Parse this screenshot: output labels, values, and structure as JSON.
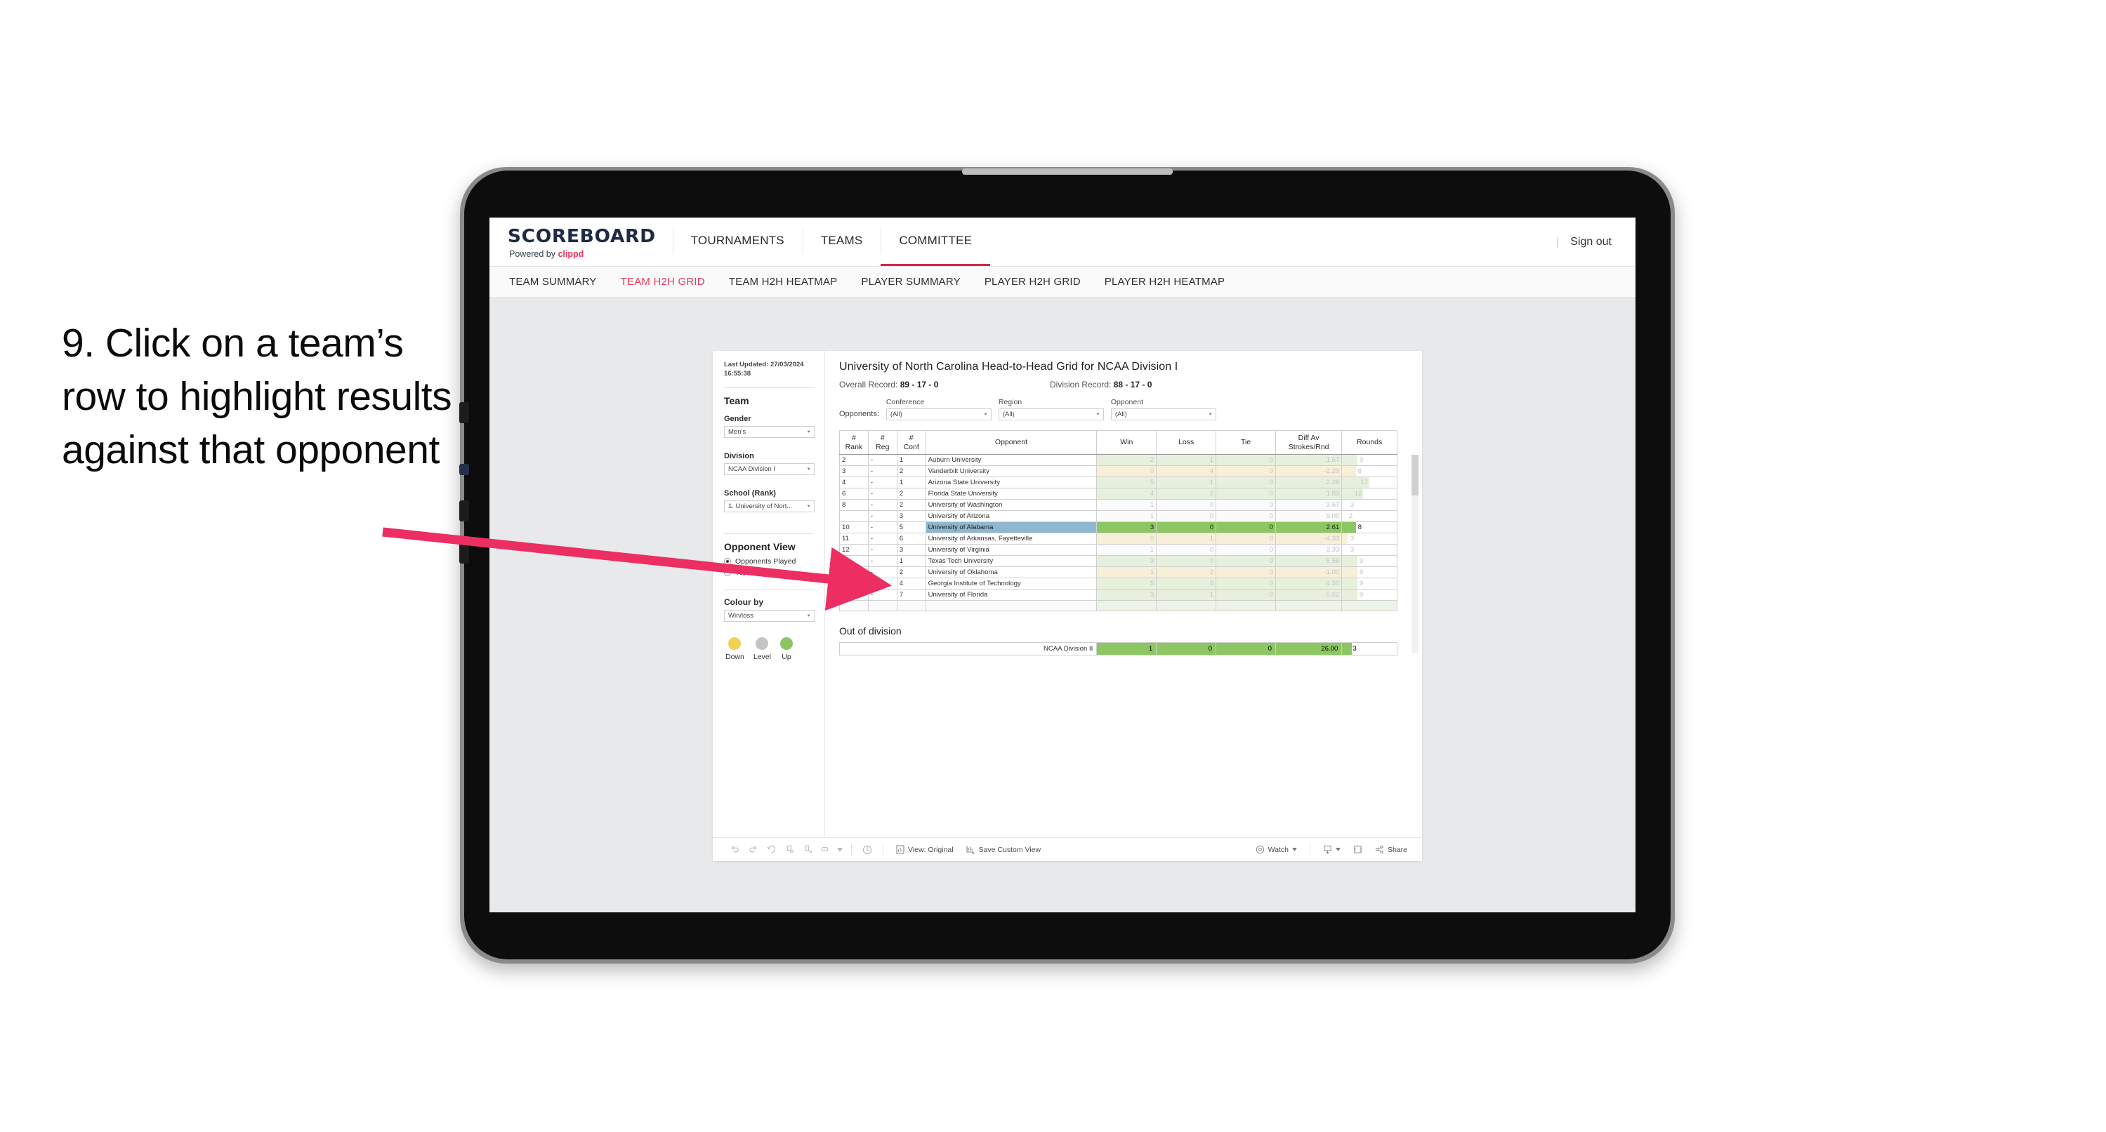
{
  "instruction": "9. Click on a team’s row to highlight results against that opponent",
  "brand": {
    "title": "SCOREBOARD",
    "powered_prefix": "Powered by ",
    "powered_name": "clippd"
  },
  "topnav": {
    "items": [
      "TOURNAMENTS",
      "TEAMS",
      "COMMITTEE"
    ],
    "active": "COMMITTEE",
    "signout": "Sign out",
    "divider": "|"
  },
  "subnav": {
    "items": [
      "TEAM SUMMARY",
      "TEAM H2H GRID",
      "TEAM H2H HEATMAP",
      "PLAYER SUMMARY",
      "PLAYER H2H GRID",
      "PLAYER H2H HEATMAP"
    ],
    "active": "TEAM H2H GRID"
  },
  "sidebar": {
    "last_updated": "Last Updated: 27/03/2024 16:55:38",
    "team_heading": "Team",
    "gender_label": "Gender",
    "gender_value": "Men’s",
    "division_label": "Division",
    "division_value": "NCAA Division I",
    "school_label": "School (Rank)",
    "school_value": "1. University of Nort...",
    "opponent_view_heading": "Opponent View",
    "opponent_view_options": [
      "Opponents Played",
      "Top 100"
    ],
    "opponent_view_selected": "Opponents Played",
    "colour_by_label": "Colour by",
    "colour_by_value": "Win/loss",
    "legend": [
      {
        "label": "Down",
        "color": "#f2d14e"
      },
      {
        "label": "Level",
        "color": "#c4c4c4"
      },
      {
        "label": "Up",
        "color": "#8dc661"
      }
    ]
  },
  "viz": {
    "title": "University of North Carolina Head-to-Head Grid for NCAA Division I",
    "overall_record_label": "Overall Record:",
    "overall_record_value": "89 - 17 - 0",
    "division_record_label": "Division Record:",
    "division_record_value": "88 - 17 - 0",
    "opponents_label": "Opponents:",
    "filters": [
      {
        "label": "Conference",
        "value": "(All)"
      },
      {
        "label": "Region",
        "value": "(All)"
      },
      {
        "label": "Opponent",
        "value": "(All)"
      }
    ],
    "out_of_division_title": "Out of division",
    "out_of_division_row": {
      "label": "NCAA Division II",
      "win": "1",
      "loss": "0",
      "tie": "0",
      "diff": "26.00",
      "rounds": "3"
    }
  },
  "chart_data": {
    "type": "table",
    "title": "University of North Carolina Head-to-Head Grid for NCAA Division I",
    "columns": [
      "# Rank",
      "# Reg",
      "# Conf",
      "Opponent",
      "Win",
      "Loss",
      "Tie",
      "Diff Av Strokes/Rnd",
      "Rounds"
    ],
    "column_headers_multiline": [
      [
        "#",
        "Rank"
      ],
      [
        "#",
        "Reg"
      ],
      [
        "#",
        "Conf"
      ],
      [
        "Opponent"
      ],
      [
        "Win"
      ],
      [
        "Loss"
      ],
      [
        "Tie"
      ],
      [
        "Diff Av",
        "Strokes/Rnd"
      ],
      [
        "Rounds"
      ]
    ],
    "rows": [
      {
        "rank": "2",
        "reg": "-",
        "conf": "1",
        "opponent": "Auburn University",
        "win": "2",
        "loss": "1",
        "tie": "0",
        "diff": "1.67",
        "rounds": "9",
        "tone": "green",
        "selected": false,
        "bar": 28
      },
      {
        "rank": "3",
        "reg": "-",
        "conf": "2",
        "opponent": "Vanderbilt University",
        "win": "0",
        "loss": "4",
        "tie": "0",
        "diff": "-2.29",
        "rounds": "8",
        "tone": "amber",
        "selected": false,
        "bar": 25
      },
      {
        "rank": "4",
        "reg": "-",
        "conf": "1",
        "opponent": "Arizona State University",
        "win": "5",
        "loss": "1",
        "tie": "0",
        "diff": "2.28",
        "rounds": "17",
        "tone": "green",
        "selected": false,
        "bar": 50
      },
      {
        "rank": "6",
        "reg": "-",
        "conf": "2",
        "opponent": "Florida State University",
        "win": "4",
        "loss": "2",
        "tie": "0",
        "diff": "1.83",
        "rounds": "12",
        "tone": "green",
        "selected": false,
        "bar": 38
      },
      {
        "rank": "8",
        "reg": "-",
        "conf": "2",
        "opponent": "University of Washington",
        "win": "1",
        "loss": "0",
        "tie": "0",
        "diff": "3.67",
        "rounds": "3",
        "tone": "white",
        "selected": false,
        "bar": 10
      },
      {
        "rank": "",
        "reg": "-",
        "conf": "3",
        "opponent": "University of Arizona",
        "win": "1",
        "loss": "0",
        "tie": "0",
        "diff": "9.00",
        "rounds": "2",
        "tone": "white",
        "selected": false,
        "bar": 7
      },
      {
        "rank": "10",
        "reg": "-",
        "conf": "5",
        "opponent": "University of Alabama",
        "win": "3",
        "loss": "0",
        "tie": "0",
        "diff": "2.61",
        "rounds": "8",
        "tone": "green",
        "selected": true,
        "bar": 25
      },
      {
        "rank": "11",
        "reg": "-",
        "conf": "6",
        "opponent": "University of Arkansas, Fayetteville",
        "win": "0",
        "loss": "1",
        "tie": "0",
        "diff": "-4.33",
        "rounds": "3",
        "tone": "amber",
        "selected": false,
        "bar": 10
      },
      {
        "rank": "12",
        "reg": "-",
        "conf": "3",
        "opponent": "University of Virginia",
        "win": "1",
        "loss": "0",
        "tie": "0",
        "diff": "2.33",
        "rounds": "3",
        "tone": "white",
        "selected": false,
        "bar": 10
      },
      {
        "rank": "13",
        "reg": "-",
        "conf": "1",
        "opponent": "Texas Tech University",
        "win": "3",
        "loss": "0",
        "tie": "0",
        "diff": "5.56",
        "rounds": "9",
        "tone": "green",
        "selected": false,
        "bar": 28
      },
      {
        "rank": "14",
        "reg": "-",
        "conf": "2",
        "opponent": "University of Oklahoma",
        "win": "1",
        "loss": "2",
        "tie": "0",
        "diff": "-1.00",
        "rounds": "9",
        "tone": "amber",
        "selected": false,
        "bar": 28
      },
      {
        "rank": "15",
        "reg": "-",
        "conf": "4",
        "opponent": "Georgia Institute of Technology",
        "win": "5",
        "loss": "0",
        "tie": "0",
        "diff": "4.50",
        "rounds": "9",
        "tone": "green",
        "selected": false,
        "bar": 28
      },
      {
        "rank": "16",
        "reg": "-",
        "conf": "7",
        "opponent": "University of Florida",
        "win": "3",
        "loss": "1",
        "tie": "0",
        "diff": "6.62",
        "rounds": "9",
        "tone": "green",
        "selected": false,
        "bar": 28
      }
    ],
    "out_of_division": {
      "label": "NCAA Division II",
      "win": "1",
      "loss": "0",
      "tie": "0",
      "diff": "26.00",
      "rounds": "3"
    },
    "legend": [
      {
        "label": "Down",
        "color": "#f2d14e"
      },
      {
        "label": "Level",
        "color": "#c4c4c4"
      },
      {
        "label": "Up",
        "color": "#8dc661"
      }
    ],
    "selected_row": "University of Alabama",
    "colors": {
      "selected_row_bg": "#8fb8d0",
      "selected_value_bg": "#8dc763",
      "positive_bg": "#e7f0dd",
      "negative_bg": "#f8efd9",
      "accent": "#d6244c",
      "arrow": "#ec2e62"
    }
  },
  "toolbar": {
    "view_label": "View: Original",
    "save_label": "Save Custom View",
    "watch_label": "Watch",
    "share_label": "Share"
  }
}
